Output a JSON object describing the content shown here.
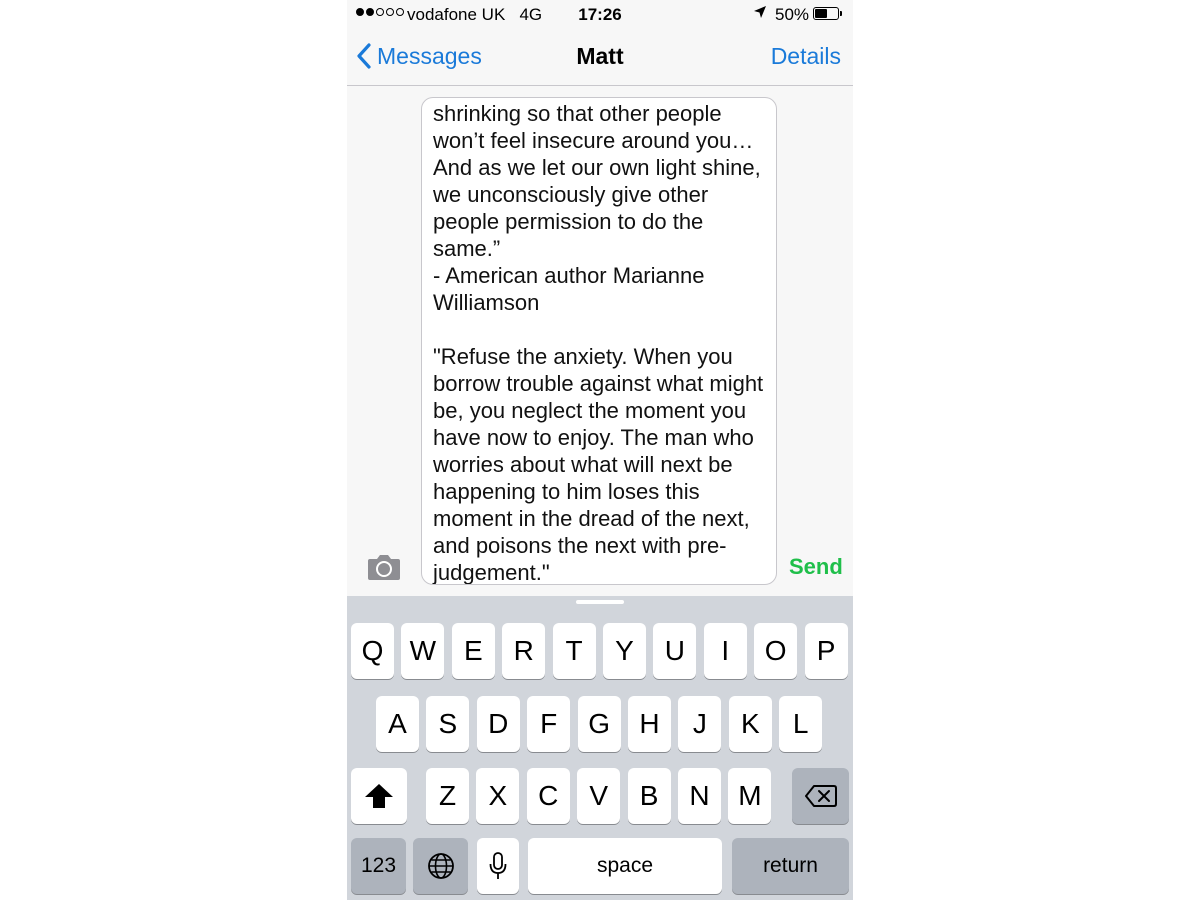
{
  "status_bar": {
    "signal": [
      true,
      true,
      false,
      false,
      false
    ],
    "carrier": "vodafone UK",
    "network": "4G",
    "time": "17:26",
    "location_icon": "location-arrow-icon",
    "battery_percent": "50%",
    "battery_level": 0.5
  },
  "nav": {
    "back_label": "Messages",
    "title": "Matt",
    "details_label": "Details"
  },
  "composer": {
    "text": "shrinking so that other people won’t feel insecure around you… And as we let our own light shine, we unconsciously give other people permission to do the same.”\n- American author Marianne Williamson\n\n\"Refuse the anxiety. When you borrow trouble against what might be, you neglect the moment you have now to enjoy. The man who worries about what will next be happening to him loses this moment in the dread of the next, and poisons the next with pre-judgement.\"",
    "send_label": "Send",
    "send_color": "#1fbf4a",
    "accent_color": "#1a7ad9"
  },
  "keyboard": {
    "row1": [
      "Q",
      "W",
      "E",
      "R",
      "T",
      "Y",
      "U",
      "I",
      "O",
      "P"
    ],
    "row2": [
      "A",
      "S",
      "D",
      "F",
      "G",
      "H",
      "J",
      "K",
      "L"
    ],
    "row3": [
      "Z",
      "X",
      "C",
      "V",
      "B",
      "N",
      "M"
    ],
    "numbers_label": "123",
    "space_label": "space",
    "return_label": "return"
  }
}
